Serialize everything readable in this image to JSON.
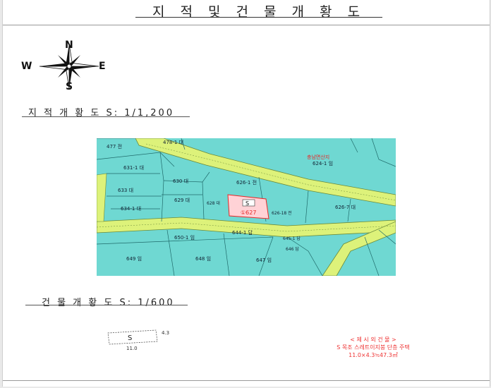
{
  "document": {
    "title": "지 적 및 건 물 개 황 도"
  },
  "compass": {
    "n": "N",
    "s": "S",
    "e": "E",
    "w": "W"
  },
  "cadastral": {
    "heading": "지 적 개 황 도 S: 1/1,200",
    "map": {
      "parcels": [
        {
          "id": "477",
          "label": "477 전"
        },
        {
          "id": "478-1",
          "label": "478-1 대"
        },
        {
          "id": "631-1",
          "label": "631-1 대"
        },
        {
          "id": "633",
          "label": "633 대"
        },
        {
          "id": "630",
          "label": "630 대"
        },
        {
          "id": "626-1",
          "label": "626-1 전"
        },
        {
          "id": "624-1",
          "label": "624-1 임"
        },
        {
          "id": "629",
          "label": "629 대"
        },
        {
          "id": "628",
          "label": "628 대"
        },
        {
          "id": "634-1",
          "label": "634-1 대"
        },
        {
          "id": "626-18",
          "label": "626-18 전"
        },
        {
          "id": "626-7",
          "label": "626-7 대"
        },
        {
          "id": "650-1",
          "label": "650-1 임"
        },
        {
          "id": "644-1",
          "label": "644-1 답"
        },
        {
          "id": "645-1",
          "label": "645-1 답"
        },
        {
          "id": "646",
          "label": "646 답"
        },
        {
          "id": "649",
          "label": "649 임"
        },
        {
          "id": "648",
          "label": "648 임"
        },
        {
          "id": "647",
          "label": "647 임"
        }
      ],
      "park_label": "충남면산지",
      "subject_marker": "S",
      "subject_parcel": "①627",
      "colors": {
        "land": "#6fd8d2",
        "road": "#ddf27a",
        "subject": "#ffd2d6",
        "red": "#e82828"
      }
    }
  },
  "building": {
    "heading": "건 물 개 황 도 S: 1/600",
    "marker": "S",
    "width": "11.0",
    "depth": "4.3",
    "legend": {
      "title": "< 제 시 외 건 물 >",
      "desc": "S 목조 스레트이지붕 단층 주택",
      "calc": "11.0×4.3≒47.3㎡"
    }
  }
}
